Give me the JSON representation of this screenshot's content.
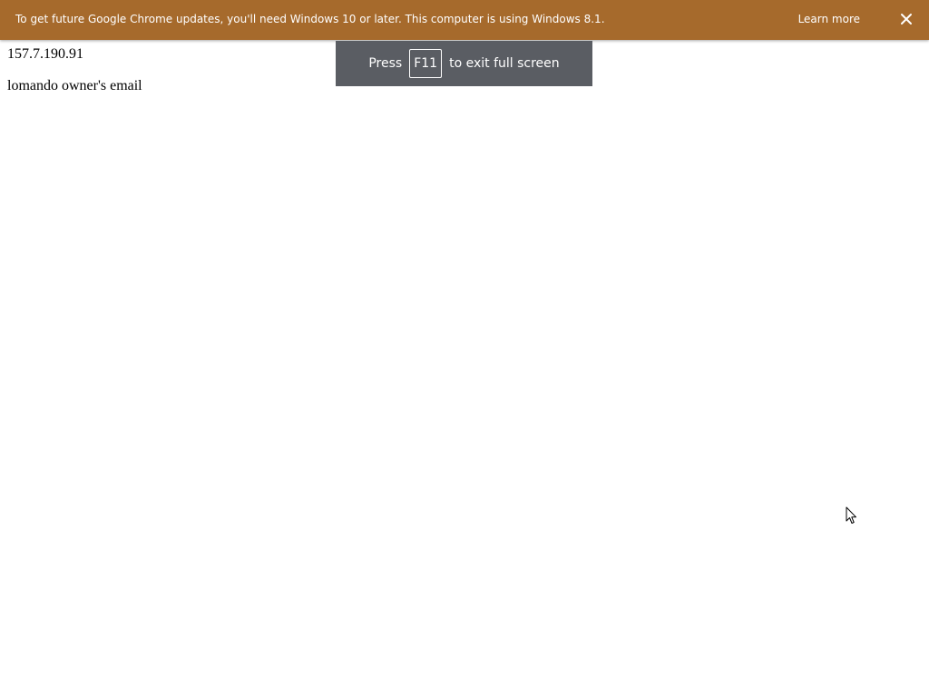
{
  "infobar": {
    "message": "To get future Google Chrome updates, you'll need Windows 10 or later. This computer is using Windows 8.1.",
    "learn_more": "Learn more",
    "close_icon": "close-icon",
    "background_color": "#a66a2c"
  },
  "page": {
    "ip_address": "157.7.190.91",
    "email_text": "lomando owner's email"
  },
  "fullscreen_toast": {
    "press": "Press",
    "key": "F11",
    "suffix": "to exit full screen",
    "background_color": "#5a5d63"
  },
  "cursor": {
    "icon": "mouse-pointer-icon"
  }
}
